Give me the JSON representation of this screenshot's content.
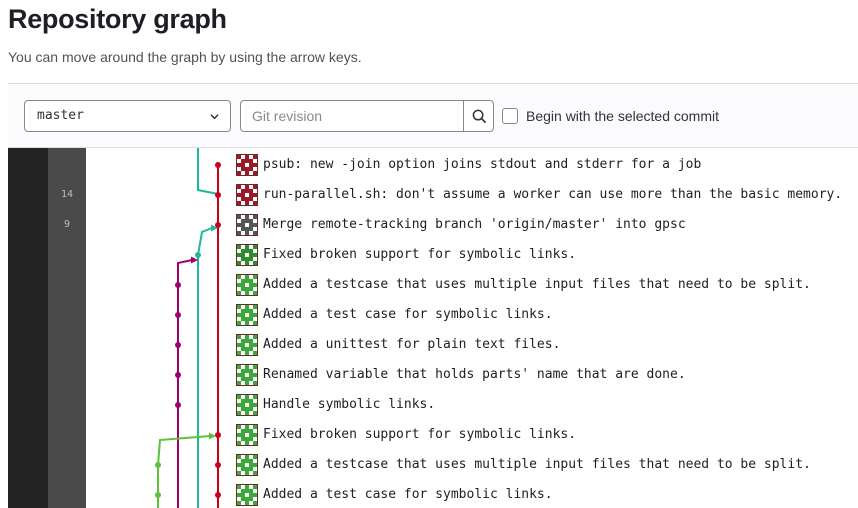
{
  "header": {
    "title": "Repository graph",
    "description": "You can move around the graph by using the arrow keys."
  },
  "controls": {
    "branch": "master",
    "revision_placeholder": "Git revision",
    "revision_value": "",
    "begin_label": "Begin with the selected commit",
    "begin_checked": false,
    "icons": [
      "chevron-down-icon",
      "search-icon"
    ]
  },
  "graph": {
    "day_labels": [
      "14",
      "9"
    ],
    "lane_colors": [
      "#c8001e",
      "#1fb89a",
      "#a1006b",
      "#5ac23c"
    ],
    "commits": [
      {
        "message": "psub: new -join option joins stdout and stderr for a job",
        "avatar": "#9a1a2a"
      },
      {
        "message": "run-parallel.sh: don't assume a worker can use more than the basic memory.",
        "avatar": "#9a1a2a"
      },
      {
        "message": "Merge remote-tracking branch 'origin/master' into gpsc",
        "avatar": "#555555"
      },
      {
        "message": "Fixed broken support for symbolic links.",
        "avatar": "#2e8b2e"
      },
      {
        "message": "Added a testcase that uses multiple input files that need to be split.",
        "avatar": "#3aa83a"
      },
      {
        "message": "Added a test case for symbolic links.",
        "avatar": "#3aa83a"
      },
      {
        "message": "Added a unittest for plain text files.",
        "avatar": "#3aa83a"
      },
      {
        "message": "Renamed variable that holds parts' name that are done.",
        "avatar": "#3aa83a"
      },
      {
        "message": "Handle symbolic links.",
        "avatar": "#3aa83a"
      },
      {
        "message": "Fixed broken support for symbolic links.",
        "avatar": "#3aa83a"
      },
      {
        "message": "Added a testcase that uses multiple input files that need to be split.",
        "avatar": "#3aa83a"
      },
      {
        "message": "Added a test case for symbolic links.",
        "avatar": "#3aa83a"
      }
    ]
  }
}
